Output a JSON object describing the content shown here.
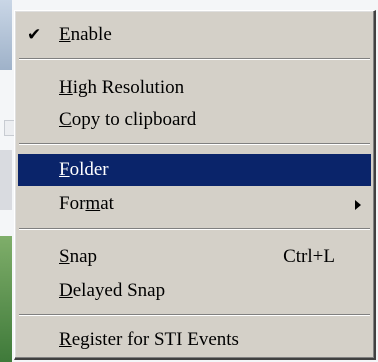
{
  "menu": {
    "items": [
      {
        "label_parts": [
          "",
          "E",
          "nable"
        ],
        "checked": true
      },
      {
        "label_parts": [
          "",
          "H",
          "igh Resolution"
        ]
      },
      {
        "label_parts": [
          "",
          "C",
          "opy to clipboard"
        ]
      },
      {
        "label_parts": [
          "",
          "F",
          "older"
        ],
        "highlighted": true
      },
      {
        "label_parts": [
          "For",
          "m",
          "at"
        ],
        "submenu": true
      },
      {
        "label_parts": [
          "",
          "S",
          "nap"
        ],
        "shortcut": "Ctrl+L"
      },
      {
        "label_parts": [
          "",
          "D",
          "elayed Snap"
        ]
      },
      {
        "label_parts": [
          "",
          "R",
          "egister for STI Events"
        ]
      }
    ],
    "check_glyph": "✔",
    "icons": {
      "check": "checkmark-icon",
      "submenu": "submenu-arrow-icon"
    },
    "colors": {
      "menu_bg": "#d4d0c8",
      "highlight_bg": "#0a246a",
      "highlight_text": "#ffffff"
    }
  }
}
